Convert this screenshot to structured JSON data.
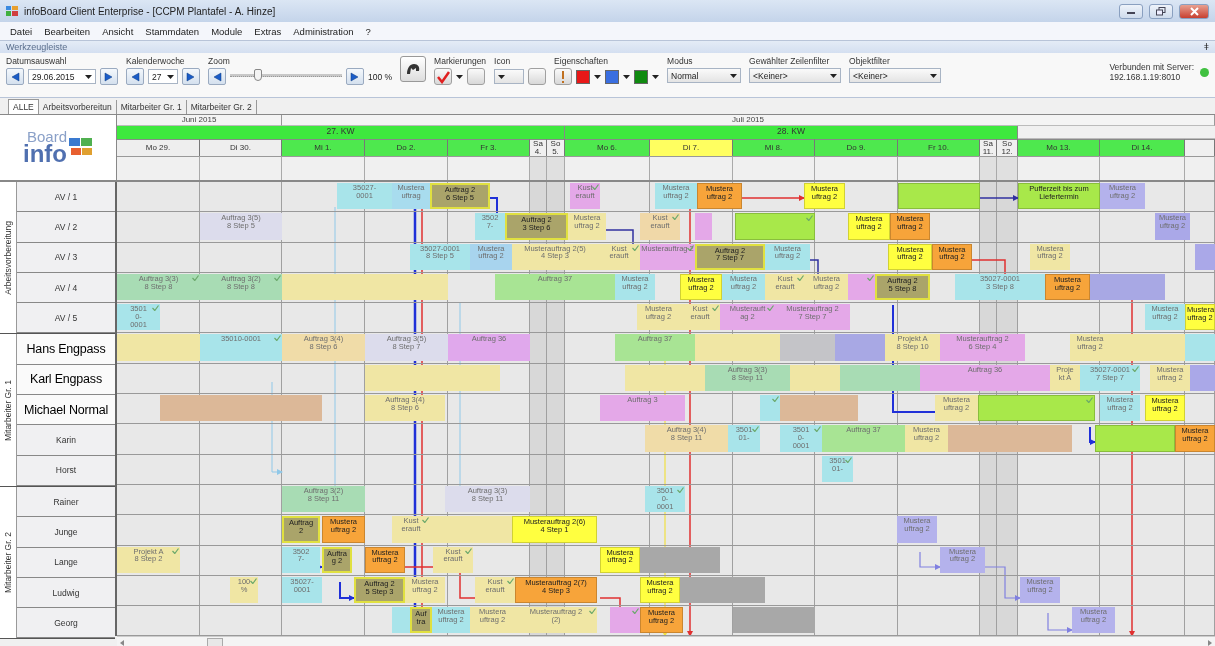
{
  "window": {
    "title": "infoBoard Client Enterprise - [CCPM Plantafel - A. Hinze]"
  },
  "menu": [
    "Datei",
    "Bearbeiten",
    "Ansicht",
    "Stammdaten",
    "Module",
    "Extras",
    "Administration",
    "?"
  ],
  "toolbar": {
    "title": "Werkzeugleiste",
    "pin": "ǂ",
    "date": {
      "label": "Datumsauswahl",
      "value": "29.06.2015"
    },
    "week": {
      "label": "Kalenderwoche",
      "value": "27"
    },
    "zoom": {
      "label": "Zoom",
      "level": 0.25,
      "value": "100 %"
    },
    "markings": {
      "label": "Markierungen",
      "checked": true
    },
    "icon": {
      "label": "Icon"
    },
    "properties": {
      "label": "Eigenschaften",
      "colors": [
        {
          "color": "#e81818"
        },
        {
          "color": "#3a6ee0"
        },
        {
          "color": "#108a10"
        }
      ]
    },
    "mode": {
      "label": "Modus",
      "value": "Normal"
    },
    "row_filter": {
      "label": "Gewählter Zeilenfilter",
      "value": "<Keiner>"
    },
    "object_filter": {
      "label": "Objektfilter",
      "value": "<Keiner>"
    },
    "server": {
      "label": "Verbunden mit Server:",
      "address": "192.168.1.19:8010",
      "connected": true
    }
  },
  "tabs": [
    {
      "label": "ALLE",
      "selected": true
    },
    {
      "label": "Arbeitsvorbereitun",
      "selected": false
    },
    {
      "label": "Mitarbeiter Gr. 1",
      "selected": false
    },
    {
      "label": "Mitarbeiter Gr. 2",
      "selected": false
    }
  ],
  "logo": {
    "top": "Board",
    "bottom": "info"
  },
  "months": [
    "Juni 2015",
    "Juli 2015"
  ],
  "weeks": [
    "27. KW",
    "28. KW"
  ],
  "days": [
    {
      "label": "Mo 29.",
      "kind": "past"
    },
    {
      "label": "Di 30.",
      "kind": "past"
    },
    {
      "label": "Mi 1.",
      "kind": "work"
    },
    {
      "label": "Do 2.",
      "kind": "work"
    },
    {
      "label": "Fr 3.",
      "kind": "work"
    },
    {
      "label": "Sa\n4.",
      "kind": "weekend"
    },
    {
      "label": "So\n5.",
      "kind": "weekend"
    },
    {
      "label": "Mo 6.",
      "kind": "work"
    },
    {
      "label": "Di 7.",
      "kind": "today"
    },
    {
      "label": "Mi 8.",
      "kind": "work"
    },
    {
      "label": "Do 9.",
      "kind": "work"
    },
    {
      "label": "Fr 10.",
      "kind": "work"
    },
    {
      "label": "Sa\n11.",
      "kind": "weekend"
    },
    {
      "label": "So\n12.",
      "kind": "weekend"
    },
    {
      "label": "Mo 13.",
      "kind": "work"
    },
    {
      "label": "Di 14.",
      "kind": "work"
    }
  ],
  "groups": [
    {
      "label": "Arbeitsvorbereitung",
      "rows": [
        {
          "name": "AV / 1",
          "highlighted": false,
          "items": [
            {
              "text": "35027-\n0001",
              "color": "#a8e4ea",
              "active": false,
              "done": false
            },
            {
              "text": "Mustera\nuftrag",
              "color": "#a8dcee",
              "active": false,
              "done": false
            },
            {
              "text": "Auftrag 2\n6  Step 5",
              "color": "#aaa46a",
              "active": true,
              "done": false
            },
            {
              "text": "Kust\nerauft",
              "color": "#e4a8e8",
              "active": false,
              "done": true
            },
            {
              "text": "Mustera\nuftrag 2",
              "color": "#a8e4ea",
              "active": false,
              "done": false
            },
            {
              "text": "Mustera\nuftrag 2",
              "color": "#f7a43a",
              "active": true,
              "done": false
            },
            {
              "text": "Mustera\nuftrag 2",
              "color": "#ffff40",
              "active": true,
              "done": false
            },
            {
              "color": "#a8e84a",
              "active": true,
              "done": false
            },
            {
              "text": "Pufferzeit bis zum\nLiefertermin",
              "color": "#a8e84a",
              "active": true,
              "done": false
            },
            {
              "text": "Mustera\nuftrag 2",
              "color": "#b4b2ec",
              "active": false,
              "done": false
            }
          ]
        },
        {
          "name": "AV / 2",
          "highlighted": false,
          "items": [
            {
              "text": "Auftrag 3(5)\n8  Step 5",
              "color": "#dcdcec",
              "active": false,
              "done": false
            },
            {
              "text": "3502\n7-",
              "color": "#a8e4ea",
              "active": false,
              "done": false
            },
            {
              "text": "Auftrag 2\n3  Step 6",
              "color": "#aaa46a",
              "active": true,
              "done": false
            },
            {
              "text": "Mustera\nuftrag 2",
              "color": "#f0e6a4",
              "active": false,
              "done": false
            },
            {
              "text": "Kust\nerauft",
              "color": "#f0d8a8",
              "active": false,
              "done": true
            },
            {
              "color": "#e4a8e8",
              "active": false,
              "done": false
            },
            {
              "color": "#a8e84a",
              "active": true,
              "done": true
            },
            {
              "text": "Mustera\nuftrag 2",
              "color": "#ffff40",
              "active": true,
              "done": false
            },
            {
              "text": "Mustera\nuftrag 2",
              "color": "#f7a43a",
              "active": true,
              "done": false
            },
            {
              "text": "Mustera\nuftrag 2",
              "color": "#aaa8e8",
              "active": false,
              "done": false
            }
          ]
        },
        {
          "name": "AV / 3",
          "highlighted": false,
          "items": [
            {
              "text": "35027-0001\n8  Step 5",
              "color": "#a8e4ea",
              "active": false,
              "done": false
            },
            {
              "text": "Mustera\nuftrag 2",
              "color": "#a8d4ee",
              "active": false,
              "done": false
            },
            {
              "text": "Musterauftrag 2(5)\n4  Step 3",
              "color": "#f0e6a4",
              "active": false,
              "done": false
            },
            {
              "text": "Kust\nerauft",
              "color": "#f0e6a4",
              "active": false,
              "done": true
            },
            {
              "text": "Musterauftrag 2",
              "color": "#e4a8e8",
              "active": false,
              "done": true
            },
            {
              "text": "Auftrag 2\n7  Step 7",
              "color": "#aaa46a",
              "active": true,
              "done": false
            },
            {
              "text": "Mustera\nuftrag 2",
              "color": "#a8e4ea",
              "active": false,
              "done": false
            },
            {
              "text": "Mustera\nuftrag 2",
              "color": "#ffff40",
              "active": true,
              "done": false
            },
            {
              "text": "Mustera\nuftrag 2",
              "color": "#f7a43a",
              "active": true,
              "done": false
            },
            {
              "text": "Mustera\nuftrag 2",
              "color": "#f0e6a4",
              "active": false,
              "done": false
            },
            {
              "color": "#aaa8e8",
              "active": false,
              "done": false
            }
          ]
        },
        {
          "name": "AV / 4",
          "highlighted": false,
          "items": [
            {
              "text": "Auftrag 3(3)\n8  Step 8",
              "color": "#a8dcb4",
              "active": false,
              "done": true
            },
            {
              "text": "Auftrag 3(2)\n8  Step 8",
              "color": "#a8dcb4",
              "active": false,
              "done": true
            },
            {
              "color": "#f0e6a4",
              "active": false,
              "done": false
            },
            {
              "text": "Auftrag 37",
              "color": "#a8e494",
              "active": false,
              "done": false
            },
            {
              "text": "Mustera\nuftrag 2",
              "color": "#a8e4ea",
              "active": false,
              "done": false
            },
            {
              "text": "Mustera\nuftrag 2",
              "color": "#ffff40",
              "active": true,
              "done": false
            },
            {
              "text": "Mustera\nuftrag 2",
              "color": "#a8e4ea",
              "active": false,
              "done": false
            },
            {
              "text": "Kust\nerauft",
              "color": "#f0e6a4",
              "active": false,
              "done": true
            },
            {
              "text": "Mustera\nuftrag 2",
              "color": "#f0e6a4",
              "active": false,
              "done": false
            },
            {
              "color": "#e4a8e8",
              "active": false,
              "done": true
            },
            {
              "text": "Auftrag 2\n5  Step 8",
              "color": "#aaa46a",
              "active": true,
              "done": false
            },
            {
              "text": "35027-0001\n3  Step 8",
              "color": "#a8e4ea",
              "active": false,
              "done": false
            },
            {
              "text": "Mustera\nuftrag 2",
              "color": "#f7a43a",
              "active": true,
              "done": false
            },
            {
              "color": "#a8a8e4",
              "active": false,
              "done": false
            }
          ]
        },
        {
          "name": "AV / 5",
          "highlighted": false,
          "items": [
            {
              "text": "3501\n0-\n0001",
              "color": "#a8e4ea",
              "active": false,
              "done": true
            },
            {
              "text": "Mustera\nuftrag 2",
              "color": "#f0e6a4",
              "active": false,
              "done": false
            },
            {
              "text": "Kust\nerauft",
              "color": "#f0e6a4",
              "active": false,
              "done": true
            },
            {
              "text": "Musterauft\nag 2",
              "color": "#e4a8e8",
              "active": false,
              "done": true
            },
            {
              "text": "Musterauftrag 2\n7  Step 7",
              "color": "#e4a8e8",
              "active": false,
              "done": false
            },
            {
              "text": "Mustera\nuftrag 2",
              "color": "#a8e4ea",
              "active": false,
              "done": false
            },
            {
              "text": "Mustera\nuftrag 2",
              "color": "#ffff40",
              "active": true,
              "done": false
            }
          ]
        }
      ]
    },
    {
      "label": "Mitarbeiter Gr. 1",
      "rows": [
        {
          "name": "Hans Engpass",
          "highlighted": true,
          "items": [
            {
              "color": "#f0e6a4",
              "active": false,
              "done": false
            },
            {
              "text": "35010-0001",
              "color": "#a8e4ea",
              "active": false,
              "done": true
            },
            {
              "text": "Auftrag 3(4)\n8  Step 6",
              "color": "#f0dca8",
              "active": false,
              "done": false
            },
            {
              "text": "Auftrag 3(5)\n8  Step 7",
              "color": "#dcdcec",
              "active": false,
              "done": false
            },
            {
              "text": "Auftrag 36",
              "color": "#e0a8ec",
              "active": false,
              "done": false
            },
            {
              "text": "Auftrag 37",
              "color": "#a8e494",
              "active": false,
              "done": false
            },
            {
              "color": "#f0e6a4",
              "active": false,
              "done": false
            },
            {
              "color": "#c4c4c8",
              "active": false,
              "done": false
            },
            {
              "color": "#a8a8e4",
              "active": false,
              "done": false
            },
            {
              "text": "Projekt A\n8  Step 10",
              "color": "#f0e6a4",
              "active": false,
              "done": false
            },
            {
              "text": "Musterauftrag 2\n6  Step 4",
              "color": "#e4a8e8",
              "active": false,
              "done": false
            },
            {
              "text": "Mustera\nuftrag 2",
              "color": "#f0e6a4",
              "active": false,
              "done": false
            },
            {
              "color": "#f0e6a4",
              "active": false,
              "done": false
            },
            {
              "color": "#a8e4ea",
              "active": false,
              "done": false
            }
          ]
        },
        {
          "name": "Karl Engpass",
          "highlighted": true,
          "items": [
            {
              "color": "#f0e6a4",
              "active": false,
              "done": false
            },
            {
              "color": "#f0e6a4",
              "active": false,
              "done": false
            },
            {
              "text": "Auftrag 3(3)\n8  Step 11",
              "color": "#a8dcb4",
              "active": false,
              "done": false
            },
            {
              "color": "#f0e6a4",
              "active": false,
              "done": false
            },
            {
              "color": "#a8dcb4",
              "active": false,
              "done": false
            },
            {
              "text": "Auftrag 36",
              "color": "#e4a8e8",
              "active": false,
              "done": false
            },
            {
              "text": "Proje\nkt A",
              "color": "#f0e6a4",
              "active": false,
              "done": false
            },
            {
              "text": "35027-0001\n7  Step 7",
              "color": "#a8e4ea",
              "active": false,
              "done": true
            },
            {
              "text": "Mustera\nuftrag 2",
              "color": "#f0e6a4",
              "active": false,
              "done": false
            },
            {
              "color": "#aaa8e8",
              "active": false,
              "done": false
            }
          ]
        },
        {
          "name": "Michael Normal",
          "highlighted": true,
          "items": [
            {
              "color": "#dcb898",
              "active": false,
              "done": false
            },
            {
              "color": "#dcb898",
              "active": false,
              "done": false
            },
            {
              "text": "Auftrag 3(4)\n8  Step 6",
              "color": "#f0e6a4",
              "active": false,
              "done": false
            },
            {
              "text": "Auftrag 3",
              "color": "#e4a8e8",
              "active": false,
              "done": false
            },
            {
              "color": "#a8e4ea",
              "active": false,
              "done": true
            },
            {
              "color": "#dcb898",
              "active": false,
              "done": false
            },
            {
              "text": "Mustera\nuftrag 2",
              "color": "#f0e6a4",
              "active": false,
              "done": false
            },
            {
              "color": "#a8e84a",
              "active": true,
              "done": true
            },
            {
              "text": "Mustera\nuftrag 2",
              "color": "#a8e4ea",
              "active": false,
              "done": false
            },
            {
              "text": "Mustera\nuftrag 2",
              "color": "#ffff40",
              "active": true,
              "done": false
            }
          ]
        },
        {
          "name": "Karin",
          "highlighted": false,
          "items": [
            {
              "text": "Auftrag 3(4)\n8  Step 11",
              "color": "#f0dca8",
              "active": false,
              "done": false
            },
            {
              "text": "3501\n01-",
              "color": "#a8e4ea",
              "active": false,
              "done": true
            },
            {
              "text": "3501\n0-\n0001",
              "color": "#a8e4ea",
              "active": false,
              "done": true
            },
            {
              "text": "Auftrag 37",
              "color": "#a8e494",
              "active": false,
              "done": false
            },
            {
              "text": "Mustera\nuftrag 2",
              "color": "#f0e6a4",
              "active": false,
              "done": false
            },
            {
              "color": "#dcb898",
              "active": false,
              "done": false
            },
            {
              "color": "#a8e84a",
              "active": true,
              "done": false
            },
            {
              "text": "Mustera\nuftrag 2",
              "color": "#f7a43a",
              "active": true,
              "done": false
            }
          ]
        },
        {
          "name": "Horst",
          "highlighted": false,
          "items": [
            {
              "text": "3501\n01-",
              "color": "#a8e4ea",
              "active": false,
              "done": true
            }
          ]
        }
      ]
    },
    {
      "label": "Mitarbeiter Gr. 2",
      "rows": [
        {
          "name": "Rainer",
          "highlighted": false,
          "items": [
            {
              "text": "Auftrag 3(2)\n8  Step 11",
              "color": "#a8dcb4",
              "active": false,
              "done": false
            },
            {
              "text": "Auftrag 3(3)\n8  Step 11",
              "color": "#dcdcec",
              "active": false,
              "done": false
            },
            {
              "text": "3501\n0-\n0001",
              "color": "#a8e4ea",
              "active": false,
              "done": true
            }
          ]
        },
        {
          "name": "Junge",
          "highlighted": false,
          "items": [
            {
              "text": "Auftrag\n2",
              "color": "#aaa46a",
              "active": true,
              "done": false
            },
            {
              "text": "Mustera\nuftrag 2",
              "color": "#f7a43a",
              "active": true,
              "done": false
            },
            {
              "text": "Kust\nerauft",
              "color": "#f0e6a4",
              "active": false,
              "done": true
            },
            {
              "color": "#f0e6a4",
              "active": false,
              "done": false
            },
            {
              "text": "Musterauftrag 2(6)\n4  Step 1",
              "color": "#ffff40",
              "active": true,
              "done": false
            },
            {
              "text": "Mustera\nuftrag 2",
              "color": "#b4b2ec",
              "active": false,
              "done": false
            }
          ]
        },
        {
          "name": "Lange",
          "highlighted": false,
          "items": [
            {
              "text": "Projekt A\n8  Step 2",
              "color": "#f0e6a4",
              "active": false,
              "done": true
            },
            {
              "text": "3502\n7-",
              "color": "#a8e4ea",
              "active": false,
              "done": false
            },
            {
              "text": "Auftra\ng 2",
              "color": "#aaa46a",
              "active": true,
              "done": false
            },
            {
              "text": "Mustera\nuftrag 2",
              "color": "#f7a43a",
              "active": true,
              "done": false
            },
            {
              "text": "Kust\nerauft",
              "color": "#f0e6a4",
              "active": false,
              "done": true
            },
            {
              "text": "Mustera\nuftrag 2",
              "color": "#ffff40",
              "active": true,
              "done": false
            },
            {
              "color": "#a8a8a8",
              "active": false,
              "done": false
            },
            {
              "text": "Mustera\nuftrag 2",
              "color": "#b4b2ec",
              "active": false,
              "done": false
            }
          ]
        },
        {
          "name": "Ludwig",
          "highlighted": false,
          "items": [
            {
              "text": "100\n%",
              "color": "#f0e6a4",
              "active": false,
              "done": true
            },
            {
              "text": "35027-\n0001",
              "color": "#a8e4ea",
              "active": false,
              "done": false
            },
            {
              "text": "Auftrag 2\n5  Step 3",
              "color": "#aaa46a",
              "active": true,
              "done": false
            },
            {
              "text": "Mustera\nuftrag 2",
              "color": "#f0e6a4",
              "active": false,
              "done": false
            },
            {
              "text": "Kust\nerauft",
              "color": "#f0e6a4",
              "active": false,
              "done": true
            },
            {
              "text": "Musterauftrag 2(7)\n4  Step 3",
              "color": "#f7a43a",
              "active": true,
              "done": false
            },
            {
              "text": "Mustera\nuftrag 2",
              "color": "#ffff40",
              "active": true,
              "done": false
            },
            {
              "color": "#a8a8a8",
              "active": false,
              "done": false
            },
            {
              "text": "Mustera\nuftrag 2",
              "color": "#b4b2ec",
              "active": false,
              "done": false
            }
          ]
        },
        {
          "name": "Georg",
          "highlighted": false,
          "items": [
            {
              "color": "#a8e4ea",
              "active": false,
              "done": false
            },
            {
              "text": "Auf\ntra",
              "color": "#aaa46a",
              "active": true,
              "done": false
            },
            {
              "text": "Mustera\nuftrag 2",
              "color": "#a8e4ea",
              "active": false,
              "done": false
            },
            {
              "text": "Mustera\nuftrag 2",
              "color": "#f0e6a4",
              "active": false,
              "done": false
            },
            {
              "text": "Musterauftrag 2\n(2)",
              "color": "#f0e6a4",
              "active": false,
              "done": true
            },
            {
              "color": "#e4a8e8",
              "active": false,
              "done": true
            },
            {
              "text": "Mustera\nuftrag 2",
              "color": "#f7a43a",
              "active": true,
              "done": false
            },
            {
              "color": "#a8a8a8",
              "active": false,
              "done": false
            },
            {
              "text": "Mustera\nuftrag 2",
              "color": "#b4b2ec",
              "active": false,
              "done": false
            }
          ]
        }
      ]
    }
  ]
}
